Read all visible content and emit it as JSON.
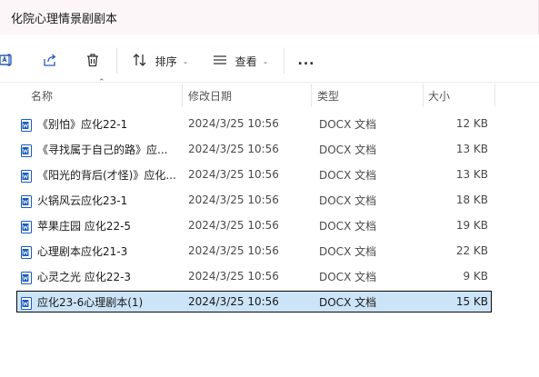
{
  "window": {
    "title": "化院心理情景剧剧本"
  },
  "toolbar": {
    "sort_label": "排序",
    "view_label": "查看",
    "more_label": "..."
  },
  "columns": {
    "name": "名称",
    "modified": "修改日期",
    "type": "类型",
    "size": "大小"
  },
  "files": [
    {
      "name": "《别怕》应化22-1",
      "modified": "2024/3/25 10:56",
      "type": "DOCX 文档",
      "size": "12 KB",
      "selected": false
    },
    {
      "name": "《寻找属于自己的路》应...",
      "modified": "2024/3/25 10:56",
      "type": "DOCX 文档",
      "size": "13 KB",
      "selected": false
    },
    {
      "name": "《阳光的背后(才怪)》应化...",
      "modified": "2024/3/25 10:56",
      "type": "DOCX 文档",
      "size": "13 KB",
      "selected": false
    },
    {
      "name": "火锅风云应化23-1",
      "modified": "2024/3/25 10:56",
      "type": "DOCX 文档",
      "size": "18 KB",
      "selected": false
    },
    {
      "name": "苹果庄园 应化22-5",
      "modified": "2024/3/25 10:56",
      "type": "DOCX 文档",
      "size": "19 KB",
      "selected": false
    },
    {
      "name": "心理剧本应化21-3",
      "modified": "2024/3/25 10:56",
      "type": "DOCX 文档",
      "size": "22 KB",
      "selected": false
    },
    {
      "name": "心灵之光 应化22-3",
      "modified": "2024/3/25 10:56",
      "type": "DOCX 文档",
      "size": "9 KB",
      "selected": false
    },
    {
      "name": "应化23-6心理剧本(1)",
      "modified": "2024/3/25 10:56",
      "type": "DOCX 文档",
      "size": "15 KB",
      "selected": true
    }
  ],
  "colors": {
    "selection_bg": "#cce4f7",
    "word_icon_blue": "#185abd"
  },
  "icons": {
    "rename": "rename-icon",
    "share": "share-icon",
    "delete": "delete-icon",
    "sort": "sort-icon",
    "view": "view-icon",
    "more": "more-icon",
    "file": "word-document-icon"
  }
}
